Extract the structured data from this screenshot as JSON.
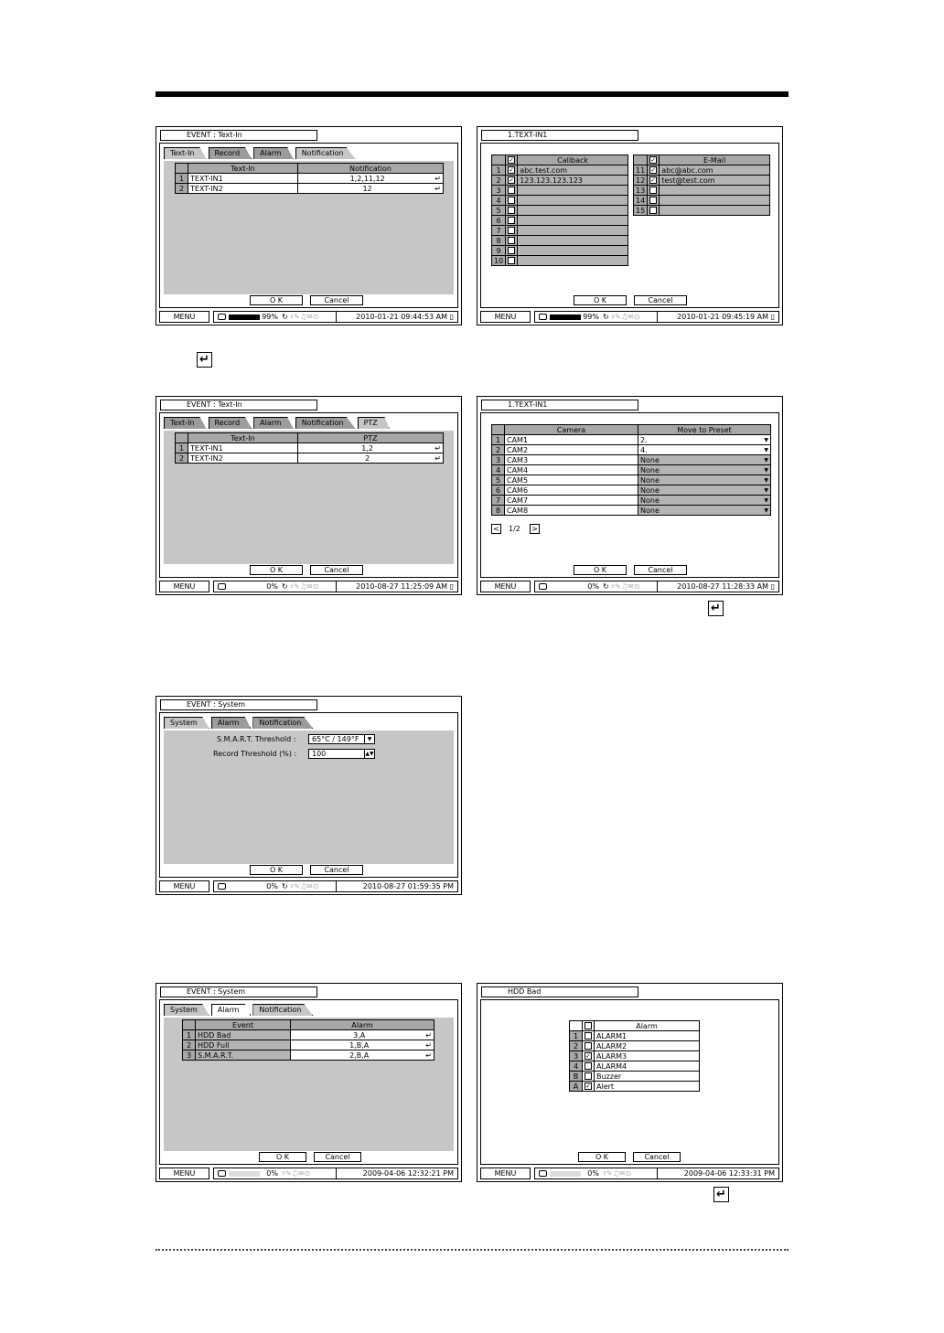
{
  "enter_glyph": "↵",
  "w1": {
    "title": "EVENT : Text-In",
    "tabs": [
      "Text-In",
      "Record",
      "Alarm",
      "Notification"
    ],
    "headers": [
      "Text-In",
      "Notification"
    ],
    "rows": [
      {
        "num": "1",
        "name": "TEXT-IN1",
        "value": "1,2,11,12"
      },
      {
        "num": "2",
        "name": "TEXT-IN2",
        "value": "12"
      }
    ],
    "ok": "O K",
    "cancel": "Cancel",
    "status": {
      "menu": "MENU",
      "pct": "99%",
      "time": "2010-01-21 09:44:53 AM"
    }
  },
  "w2": {
    "title": "1.TEXT-IN1",
    "left_header": "Callback",
    "left_rows": [
      {
        "num": "1",
        "checked": true,
        "text": "abc.test.com"
      },
      {
        "num": "2",
        "checked": true,
        "text": "123.123.123.123"
      },
      {
        "num": "3",
        "checked": false,
        "text": ""
      },
      {
        "num": "4",
        "checked": false,
        "text": ""
      },
      {
        "num": "5",
        "checked": false,
        "text": ""
      },
      {
        "num": "6",
        "checked": false,
        "text": ""
      },
      {
        "num": "7",
        "checked": false,
        "text": ""
      },
      {
        "num": "8",
        "checked": false,
        "text": ""
      },
      {
        "num": "9",
        "checked": false,
        "text": ""
      },
      {
        "num": "10",
        "checked": false,
        "text": ""
      }
    ],
    "right_header": "E-Mail",
    "right_rows": [
      {
        "num": "11",
        "checked": true,
        "text": "abc@abc.com"
      },
      {
        "num": "12",
        "checked": true,
        "text": "test@test.com"
      },
      {
        "num": "13",
        "checked": false,
        "text": ""
      },
      {
        "num": "14",
        "checked": false,
        "text": ""
      },
      {
        "num": "15",
        "checked": false,
        "text": ""
      }
    ],
    "ok": "O K",
    "cancel": "Cancel",
    "status": {
      "menu": "MENU",
      "pct": "99%",
      "time": "2010-01-21 09:45:19 AM"
    }
  },
  "w3": {
    "title": "EVENT : Text-In",
    "tabs": [
      "Text-In",
      "Record",
      "Alarm",
      "Notification",
      "PTZ"
    ],
    "headers": [
      "Text-In",
      "PTZ"
    ],
    "rows": [
      {
        "num": "1",
        "name": "TEXT-IN1",
        "value": "1,2"
      },
      {
        "num": "2",
        "name": "TEXT-IN2",
        "value": "2"
      }
    ],
    "ok": "O K",
    "cancel": "Cancel",
    "status": {
      "menu": "MENU",
      "pct": "0%",
      "time": "2010-08-27 11:25:09 AM"
    }
  },
  "w4": {
    "title": "1.TEXT-IN1",
    "headers": [
      "Camera",
      "Move to Preset"
    ],
    "rows": [
      {
        "num": "1",
        "cam": "CAM1",
        "preset": "2.",
        "active": true
      },
      {
        "num": "2",
        "cam": "CAM2",
        "preset": "4.",
        "active": true
      },
      {
        "num": "3",
        "cam": "CAM3",
        "preset": "None",
        "active": false
      },
      {
        "num": "4",
        "cam": "CAM4",
        "preset": "None",
        "active": false
      },
      {
        "num": "5",
        "cam": "CAM5",
        "preset": "None",
        "active": false
      },
      {
        "num": "6",
        "cam": "CAM6",
        "preset": "None",
        "active": false
      },
      {
        "num": "7",
        "cam": "CAM7",
        "preset": "None",
        "active": false
      },
      {
        "num": "8",
        "cam": "CAM8",
        "preset": "None",
        "active": false
      }
    ],
    "page": "1/2",
    "ok": "O K",
    "cancel": "Cancel",
    "status": {
      "menu": "MENU",
      "pct": "0%",
      "time": "2010-08-27 11:28:33 AM"
    }
  },
  "w5": {
    "title": "EVENT : System",
    "tabs": [
      "System",
      "Alarm",
      "Notification"
    ],
    "smart_label": "S.M.A.R.T. Threshold :",
    "smart_value": "65°C / 149°F",
    "record_label": "Record Threshold (%) :",
    "record_value": "100",
    "ok": "O K",
    "cancel": "Cancel",
    "status": {
      "menu": "MENU",
      "pct": "0%",
      "time": "2010-08-27 01:59:35 PM"
    }
  },
  "w6": {
    "title": "EVENT : System",
    "tabs": [
      "System",
      "Alarm",
      "Notification"
    ],
    "headers": [
      "Event",
      "Alarm"
    ],
    "rows": [
      {
        "num": "1",
        "name": "HDD Bad",
        "value": "3,A"
      },
      {
        "num": "2",
        "name": "HDD Full",
        "value": "1,B,A"
      },
      {
        "num": "3",
        "name": "S.M.A.R.T.",
        "value": "2,B,A"
      }
    ],
    "ok": "O K",
    "cancel": "Cancel",
    "status": {
      "menu": "MENU",
      "pct": "0%",
      "time": "2009-04-06  12:32:21 PM"
    }
  },
  "w7": {
    "title": "HDD Bad",
    "header": "Alarm",
    "rows": [
      {
        "num": "1",
        "checked": false,
        "text": "ALARM1"
      },
      {
        "num": "2",
        "checked": false,
        "text": "ALARM2"
      },
      {
        "num": "3",
        "checked": true,
        "text": "ALARM3"
      },
      {
        "num": "4",
        "checked": false,
        "text": "ALARM4"
      },
      {
        "num": "B",
        "checked": false,
        "text": "Buzzer"
      },
      {
        "num": "A",
        "checked": true,
        "text": "Alert"
      }
    ],
    "ok": "O K",
    "cancel": "Cancel",
    "status": {
      "menu": "MENU",
      "pct": "0%",
      "time": "2009-04-06  12:33:31 PM"
    }
  }
}
